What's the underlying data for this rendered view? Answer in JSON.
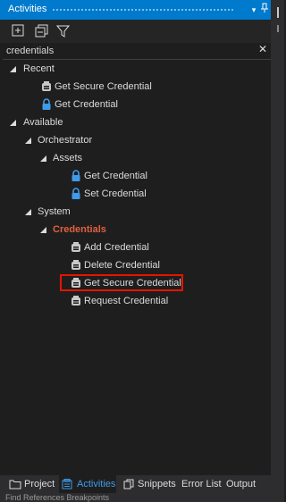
{
  "panel": {
    "title": "Activities",
    "pin_glyph": "▾ ⊓",
    "search": {
      "value": "credentials",
      "clear_glyph": "✕"
    }
  },
  "tree": {
    "recent": {
      "label": "Recent",
      "items": [
        "Get Secure Credential",
        "Get Credential"
      ]
    },
    "available": {
      "label": "Available",
      "orchestrator": {
        "label": "Orchestrator",
        "assets": {
          "label": "Assets",
          "items": [
            "Get Credential",
            "Set Credential"
          ]
        }
      },
      "system": {
        "label": "System",
        "credentials": {
          "label": "Credentials",
          "items": [
            "Add Credential",
            "Delete Credential",
            "Get Secure Credential",
            "Request Credential"
          ]
        }
      }
    }
  },
  "bottom_tabs": [
    "Project",
    "Activities",
    "Snippets",
    "Error List",
    "Output"
  ],
  "status_text": "Find References    Breakpoints",
  "colors": {
    "accent": "#007acc",
    "highlight": "#e51400",
    "category": "#e0603e"
  }
}
